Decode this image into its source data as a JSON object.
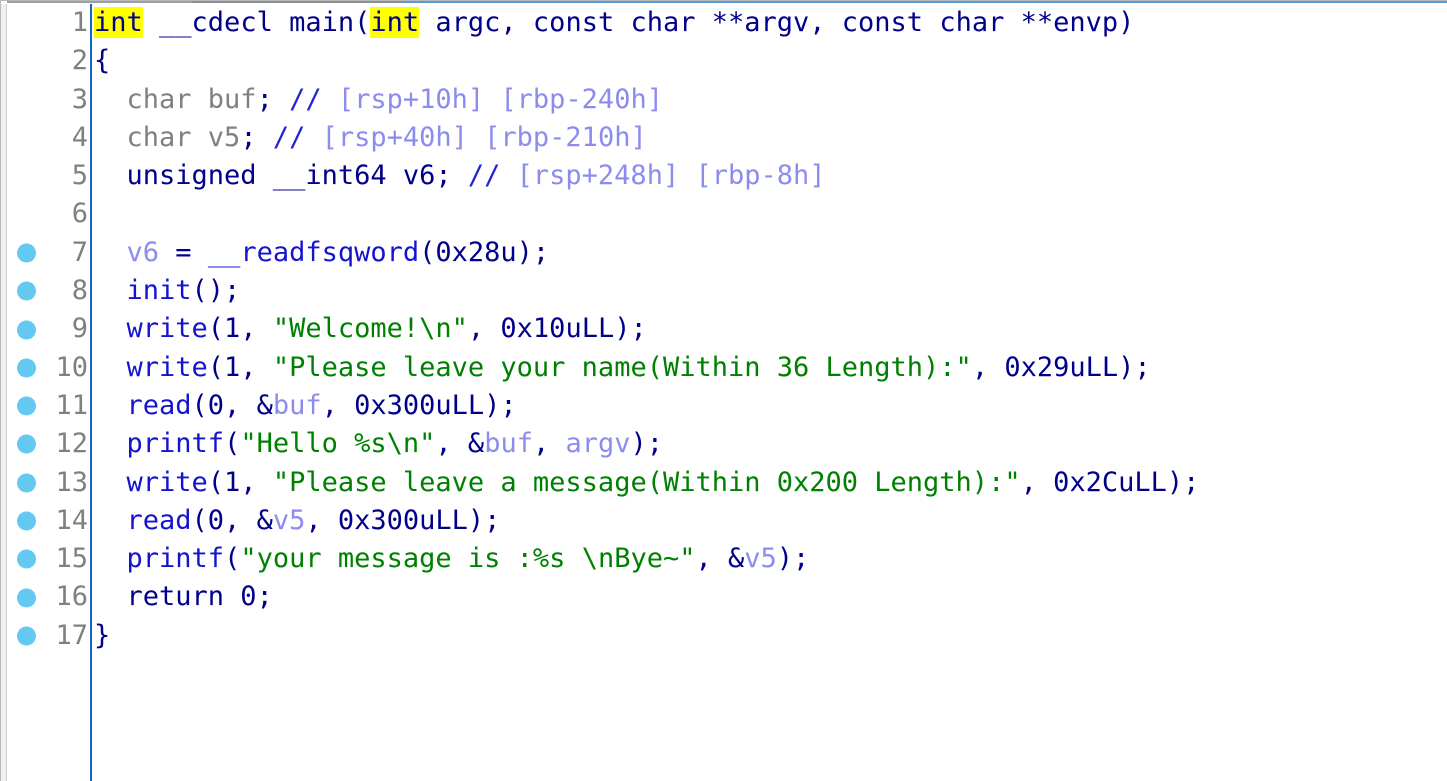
{
  "view": {
    "kind": "ida-pseudocode",
    "gutter_rule_color": "#1565c0",
    "breakpoint_color": "#63c9f0",
    "highlight_color": "#ffff00",
    "background": "#ffffff"
  },
  "colors": {
    "keyword": "#00008b",
    "function": "#1414cf",
    "variable": "#8c8cee",
    "string": "#008000",
    "type_gray": "#808080",
    "comment": "#8c8cee",
    "linenumber": "#808080"
  },
  "lines": [
    {
      "number": "1",
      "breakpoint": false,
      "tokens": [
        {
          "t": "int",
          "c": "hl"
        },
        {
          "t": " __cdecl main(",
          "c": "kw"
        },
        {
          "t": "int",
          "c": "hl"
        },
        {
          "t": " argc, const char **argv, const char **envp)",
          "c": "kw"
        }
      ]
    },
    {
      "number": "2",
      "breakpoint": false,
      "tokens": [
        {
          "t": "{",
          "c": "kw"
        }
      ]
    },
    {
      "number": "3",
      "breakpoint": false,
      "tokens": [
        {
          "t": "  ",
          "c": "kw"
        },
        {
          "t": "char buf",
          "c": "type"
        },
        {
          "t": "; ",
          "c": "kw"
        },
        {
          "t": "//",
          "c": "cmtsl"
        },
        {
          "t": " [rsp+10h] [rbp-240h]",
          "c": "cmt"
        }
      ]
    },
    {
      "number": "4",
      "breakpoint": false,
      "tokens": [
        {
          "t": "  ",
          "c": "kw"
        },
        {
          "t": "char v5",
          "c": "type"
        },
        {
          "t": "; ",
          "c": "kw"
        },
        {
          "t": "//",
          "c": "cmtsl"
        },
        {
          "t": " [rsp+40h] [rbp-210h]",
          "c": "cmt"
        }
      ]
    },
    {
      "number": "5",
      "breakpoint": false,
      "tokens": [
        {
          "t": "  unsigned __int64 v6; ",
          "c": "kw"
        },
        {
          "t": "//",
          "c": "cmtsl"
        },
        {
          "t": " [rsp+248h] [rbp-8h]",
          "c": "cmt"
        }
      ]
    },
    {
      "number": "6",
      "breakpoint": false,
      "tokens": []
    },
    {
      "number": "7",
      "breakpoint": true,
      "tokens": [
        {
          "t": "  ",
          "c": "kw"
        },
        {
          "t": "v6",
          "c": "var"
        },
        {
          "t": " = ",
          "c": "kw"
        },
        {
          "t": "__readfsqword",
          "c": "fn"
        },
        {
          "t": "(0x28u);",
          "c": "kw"
        }
      ]
    },
    {
      "number": "8",
      "breakpoint": true,
      "tokens": [
        {
          "t": "  ",
          "c": "kw"
        },
        {
          "t": "init",
          "c": "fn"
        },
        {
          "t": "();",
          "c": "kw"
        }
      ]
    },
    {
      "number": "9",
      "breakpoint": true,
      "tokens": [
        {
          "t": "  ",
          "c": "kw"
        },
        {
          "t": "write",
          "c": "fn"
        },
        {
          "t": "(1, ",
          "c": "kw"
        },
        {
          "t": "\"Welcome!\\n\"",
          "c": "str"
        },
        {
          "t": ", 0x10uLL);",
          "c": "kw"
        }
      ]
    },
    {
      "number": "10",
      "breakpoint": true,
      "tokens": [
        {
          "t": "  ",
          "c": "kw"
        },
        {
          "t": "write",
          "c": "fn"
        },
        {
          "t": "(1, ",
          "c": "kw"
        },
        {
          "t": "\"Please leave your name(Within 36 Length):\"",
          "c": "str"
        },
        {
          "t": ", 0x29uLL);",
          "c": "kw"
        }
      ]
    },
    {
      "number": "11",
      "breakpoint": true,
      "tokens": [
        {
          "t": "  ",
          "c": "kw"
        },
        {
          "t": "read",
          "c": "fn"
        },
        {
          "t": "(0, &",
          "c": "kw"
        },
        {
          "t": "buf",
          "c": "var"
        },
        {
          "t": ", 0x300uLL);",
          "c": "kw"
        }
      ]
    },
    {
      "number": "12",
      "breakpoint": true,
      "tokens": [
        {
          "t": "  ",
          "c": "kw"
        },
        {
          "t": "printf",
          "c": "fn"
        },
        {
          "t": "(",
          "c": "kw"
        },
        {
          "t": "\"Hello %s\\n\"",
          "c": "str"
        },
        {
          "t": ", &",
          "c": "kw"
        },
        {
          "t": "buf",
          "c": "var"
        },
        {
          "t": ", ",
          "c": "kw"
        },
        {
          "t": "argv",
          "c": "var"
        },
        {
          "t": ");",
          "c": "kw"
        }
      ]
    },
    {
      "number": "13",
      "breakpoint": true,
      "tokens": [
        {
          "t": "  ",
          "c": "kw"
        },
        {
          "t": "write",
          "c": "fn"
        },
        {
          "t": "(1, ",
          "c": "kw"
        },
        {
          "t": "\"Please leave a message(Within 0x200 Length):\"",
          "c": "str"
        },
        {
          "t": ", 0x2CuLL);",
          "c": "kw"
        }
      ]
    },
    {
      "number": "14",
      "breakpoint": true,
      "tokens": [
        {
          "t": "  ",
          "c": "kw"
        },
        {
          "t": "read",
          "c": "fn"
        },
        {
          "t": "(0, &",
          "c": "kw"
        },
        {
          "t": "v5",
          "c": "var"
        },
        {
          "t": ", 0x300uLL);",
          "c": "kw"
        }
      ]
    },
    {
      "number": "15",
      "breakpoint": true,
      "tokens": [
        {
          "t": "  ",
          "c": "kw"
        },
        {
          "t": "printf",
          "c": "fn"
        },
        {
          "t": "(",
          "c": "kw"
        },
        {
          "t": "\"your message is :%s \\nBye~\"",
          "c": "str"
        },
        {
          "t": ", &",
          "c": "kw"
        },
        {
          "t": "v5",
          "c": "var"
        },
        {
          "t": ");",
          "c": "kw"
        }
      ]
    },
    {
      "number": "16",
      "breakpoint": true,
      "tokens": [
        {
          "t": "  return 0;",
          "c": "kw"
        }
      ]
    },
    {
      "number": "17",
      "breakpoint": true,
      "tokens": [
        {
          "t": "}",
          "c": "kw"
        }
      ]
    }
  ]
}
